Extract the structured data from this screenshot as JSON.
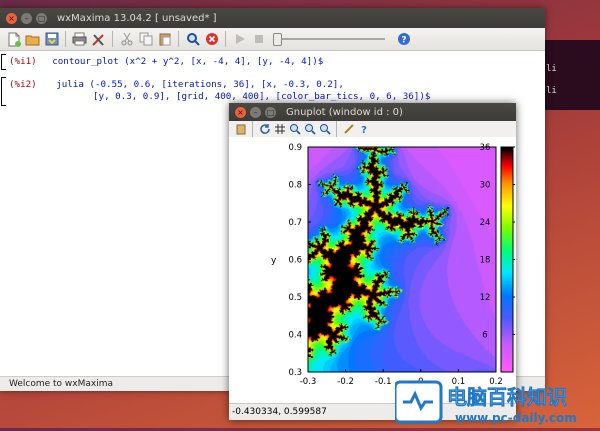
{
  "desktop": {
    "term_lines": [
      "li",
      "li"
    ]
  },
  "wxmaxima": {
    "title": "wxMaxima 13.04.2 [ unsaved* ]",
    "toolbar_icons": [
      "new-icon",
      "open-icon",
      "save-icon",
      "print-icon",
      "preferences-icon",
      "cut-icon",
      "copy-icon",
      "paste-icon",
      "find-icon",
      "interrupt-icon",
      "play-icon",
      "stop-icon",
      "help-icon"
    ],
    "cells": [
      {
        "label": "(%i1)",
        "lines": [
          "contour_plot (x^2 + y^2, [x, -4, 4], [y, -4, 4])$"
        ]
      },
      {
        "label": "(%i2)",
        "lines": [
          "julia (-0.55, 0.6, [iterations, 36], [x, -0.3, 0.2],",
          "[y, 0.3, 0.9], [grid, 400, 400], [color_bar_tics, 0, 6, 36])$"
        ]
      }
    ],
    "status": "Welcome to wxMaxima"
  },
  "gnuplot": {
    "title": "Gnuplot (window id : 0)",
    "status": "-0.430334, 0.599587"
  },
  "chart_data": {
    "type": "heatmap",
    "title": "",
    "xlabel": "",
    "ylabel": "y",
    "xlim": [
      -0.3,
      0.2
    ],
    "ylim": [
      0.3,
      0.9
    ],
    "x_ticks": [
      "-0.3",
      "-0.2",
      "-0.1",
      "0",
      "0.1",
      "0.2"
    ],
    "y_ticks": [
      "0.3",
      "0.4",
      "0.5",
      "0.6",
      "0.7",
      "0.8",
      "0.9"
    ],
    "colorbar_range": [
      0,
      36
    ],
    "colorbar_ticks": [
      "6",
      "12",
      "18",
      "24",
      "30",
      "36"
    ],
    "c": {
      "re": -0.55,
      "im": 0.6
    },
    "iterations": 36,
    "grid": [
      400,
      400
    ]
  },
  "watermark": {
    "text": "电脑百科知识",
    "url": "www.pc-daily.com"
  }
}
